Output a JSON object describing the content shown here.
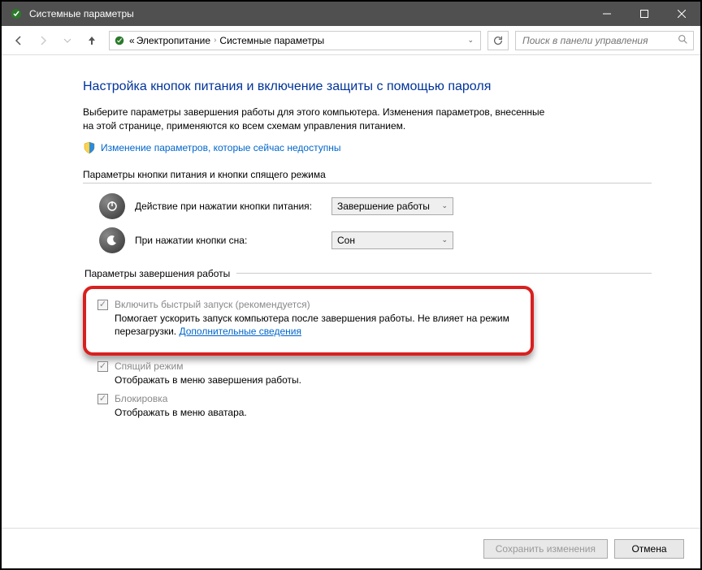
{
  "window": {
    "title": "Системные параметры"
  },
  "nav": {
    "breadcrumb_prefix": "«",
    "breadcrumb1": "Электропитание",
    "breadcrumb2": "Системные параметры",
    "search_placeholder": "Поиск в панели управления"
  },
  "page": {
    "title": "Настройка кнопок питания и включение защиты с помощью пароля",
    "description": "Выберите параметры завершения работы для этого компьютера. Изменения параметров, внесенные на этой странице, применяются ко всем схемам управления питанием.",
    "change_link": "Изменение параметров, которые сейчас недоступны"
  },
  "section_buttons": {
    "heading": "Параметры кнопки питания и кнопки спящего режима",
    "power_label": "Действие при нажатии кнопки питания:",
    "power_value": "Завершение работы",
    "sleep_label": "При нажатии кнопки сна:",
    "sleep_value": "Сон"
  },
  "section_shutdown": {
    "heading": "Параметры завершения работы",
    "fast_startup_label": "Включить быстрый запуск (рекомендуется)",
    "fast_startup_desc": "Помогает ускорить запуск компьютера после завершения работы. Не влияет на режим перезагрузки. ",
    "more_info": "Дополнительные сведения",
    "sleep_label": "Спящий режим",
    "sleep_desc": "Отображать в меню завершения работы.",
    "lock_label": "Блокировка",
    "lock_desc": "Отображать в меню аватара."
  },
  "footer": {
    "save": "Сохранить изменения",
    "cancel": "Отмена"
  }
}
